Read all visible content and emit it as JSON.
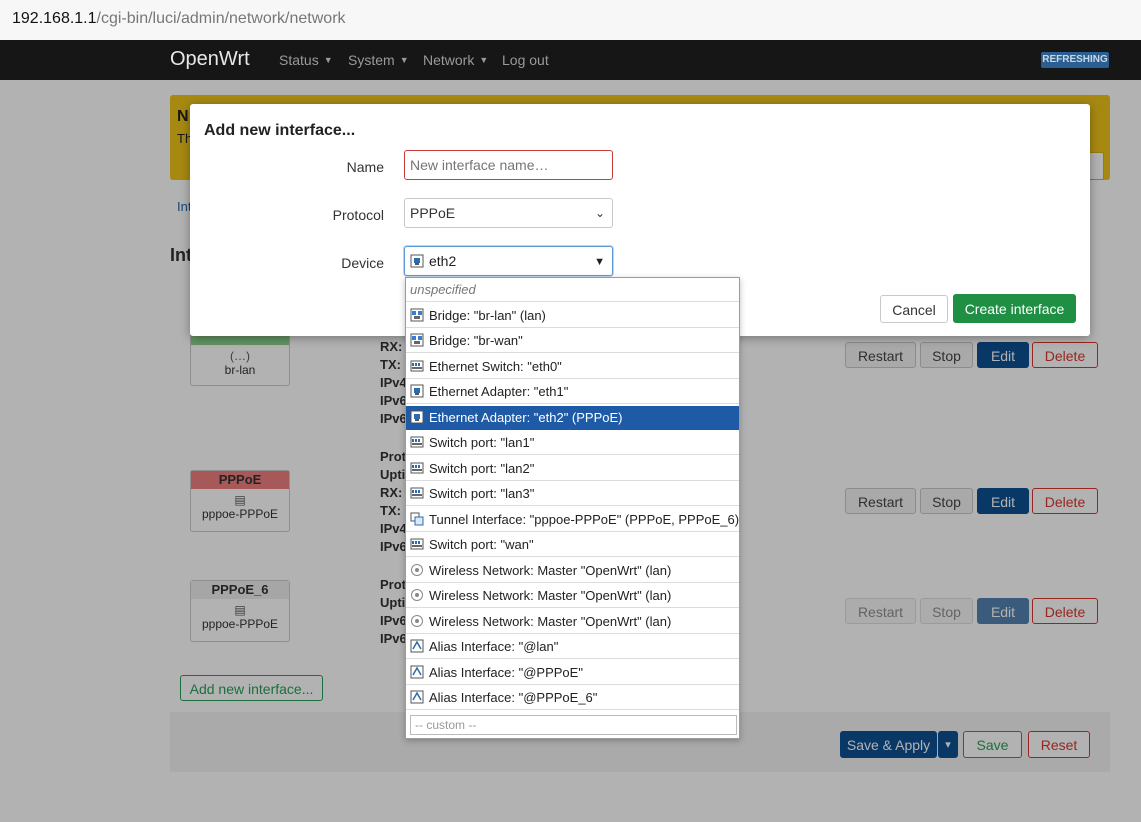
{
  "browser": {
    "url_host": "192.168.1.1",
    "url_path": "/cgi-bin/luci/admin/network/network"
  },
  "nav": {
    "brand": "OpenWrt",
    "items": [
      {
        "label": "Status"
      },
      {
        "label": "System"
      },
      {
        "label": "Network"
      },
      {
        "label": "Log out"
      }
    ],
    "badge": "REFRESHING"
  },
  "background": {
    "warning_title": "N",
    "warning_text": "Th",
    "tab_label": "Int",
    "section_title": "Int",
    "interfaces": [
      {
        "header": "",
        "glyph": "(…)",
        "device": "br-lan",
        "stats": [
          "RX:",
          "TX:",
          "IPv4",
          "IPv6",
          "IPv6"
        ],
        "header_color": "#8fd18f"
      },
      {
        "header": "PPPoE",
        "glyph": "▤",
        "device": "pppoe-PPPoE",
        "stats": [
          "Prot",
          "Upti",
          "RX:",
          "TX:",
          "IPv4",
          "IPv6"
        ],
        "header_color": "#f08080"
      },
      {
        "header": "PPPoE_6",
        "glyph": "▤",
        "device": "pppoe-PPPoE",
        "stats": [
          "Prot",
          "Upti",
          "IPv6",
          "IPv6"
        ],
        "header_color": "#eeeeee"
      }
    ],
    "row_buttons": {
      "restart": "Restart",
      "stop": "Stop",
      "edit": "Edit",
      "delete": "Delete"
    },
    "add_interface": "Add new interface...",
    "save_apply": "Save & Apply",
    "save_apply_caret": "▾",
    "save": "Save",
    "reset": "Reset"
  },
  "modal": {
    "title": "Add new interface...",
    "name_label": "Name",
    "name_placeholder": "New interface name…",
    "protocol_label": "Protocol",
    "protocol_value": "PPPoE",
    "protocol_chevron": "⌄",
    "device_label": "Device",
    "device_value": "eth2",
    "device_arrow": "▼",
    "cancel": "Cancel",
    "create": "Create interface"
  },
  "dropdown": {
    "options": [
      {
        "label": "unspecified",
        "icon": "none"
      },
      {
        "label": "Bridge: \"br-lan\" (lan)",
        "icon": "bridge-icon"
      },
      {
        "label": "Bridge: \"br-wan\"",
        "icon": "bridge-icon"
      },
      {
        "label": "Ethernet Switch: \"eth0\"",
        "icon": "switch-icon"
      },
      {
        "label": "Ethernet Adapter: \"eth1\"",
        "icon": "ethernet-icon"
      },
      {
        "label": "Ethernet Adapter: \"eth2\" (PPPoE)",
        "icon": "ethernet-icon",
        "selected": true
      },
      {
        "label": "Switch port: \"lan1\"",
        "icon": "switch-icon"
      },
      {
        "label": "Switch port: \"lan2\"",
        "icon": "switch-icon"
      },
      {
        "label": "Switch port: \"lan3\"",
        "icon": "switch-icon"
      },
      {
        "label": "Tunnel Interface: \"pppoe-PPPoE\" (PPPoE, PPPoE_6)",
        "icon": "tunnel-icon"
      },
      {
        "label": "Switch port: \"wan\"",
        "icon": "switch-icon"
      },
      {
        "label": "Wireless Network: Master \"OpenWrt\" (lan)",
        "icon": "wifi-icon"
      },
      {
        "label": "Wireless Network: Master \"OpenWrt\" (lan)",
        "icon": "wifi-icon"
      },
      {
        "label": "Wireless Network: Master \"OpenWrt\" (lan)",
        "icon": "wifi-icon"
      },
      {
        "label": "Alias Interface: \"@lan\"",
        "icon": "alias-icon"
      },
      {
        "label": "Alias Interface: \"@PPPoE\"",
        "icon": "alias-icon"
      },
      {
        "label": "Alias Interface: \"@PPPoE_6\"",
        "icon": "alias-icon"
      }
    ],
    "custom_placeholder": "-- custom --"
  }
}
